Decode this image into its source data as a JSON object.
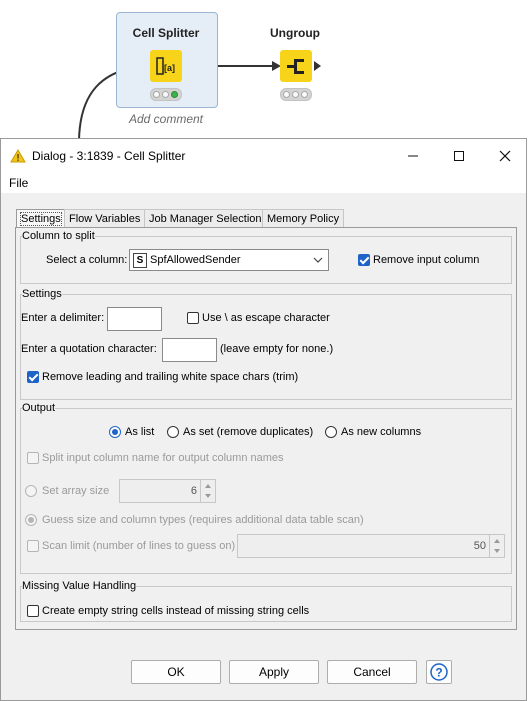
{
  "workflow": {
    "node1_title": "Cell Splitter",
    "node2_title": "Ungroup",
    "add_comment": "Add comment"
  },
  "dialog": {
    "title": "Dialog - 3:1839 - Cell Splitter",
    "menu_file": "File",
    "tabs": [
      "Settings",
      "Flow Variables",
      "Job Manager Selection",
      "Memory Policy"
    ],
    "column_group": {
      "title": "Column to split",
      "select_label": "Select a column:",
      "selected_column": "SpfAllowedSender",
      "column_type_glyph": "S",
      "remove_input_label": "Remove input column",
      "remove_input_checked": true
    },
    "settings_group": {
      "title": "Settings",
      "delimiter_label": "Enter a delimiter:",
      "delimiter_value": "",
      "escape_label": "Use \\ as escape character",
      "escape_checked": false,
      "quote_label": "Enter a quotation character:",
      "quote_value": "",
      "quote_hint": "(leave empty for none.)",
      "trim_label": "Remove leading and trailing white space chars (trim)",
      "trim_checked": true
    },
    "output_group": {
      "title": "Output",
      "radio_list": "As list",
      "radio_set": "As set (remove duplicates)",
      "radio_columns": "As new columns",
      "selected_output": "As list",
      "split_names_label": "Split input column name for output column names",
      "set_array_label": "Set array size",
      "array_size": "6",
      "guess_label": "Guess size and column types (requires additional data table scan)",
      "scan_limit_label": "Scan limit (number of lines to guess on)",
      "scan_limit": "50"
    },
    "missing_group": {
      "title": "Missing Value Handling",
      "empty_cells_label": "Create empty string cells instead of missing string cells",
      "empty_cells_checked": false
    },
    "buttons": {
      "ok": "OK",
      "apply": "Apply",
      "cancel": "Cancel",
      "help": "?"
    }
  },
  "colors": {
    "node_yellow": "#f7d31a",
    "accent_blue": "#1e64c8",
    "warning_yellow": "#f0c419"
  }
}
